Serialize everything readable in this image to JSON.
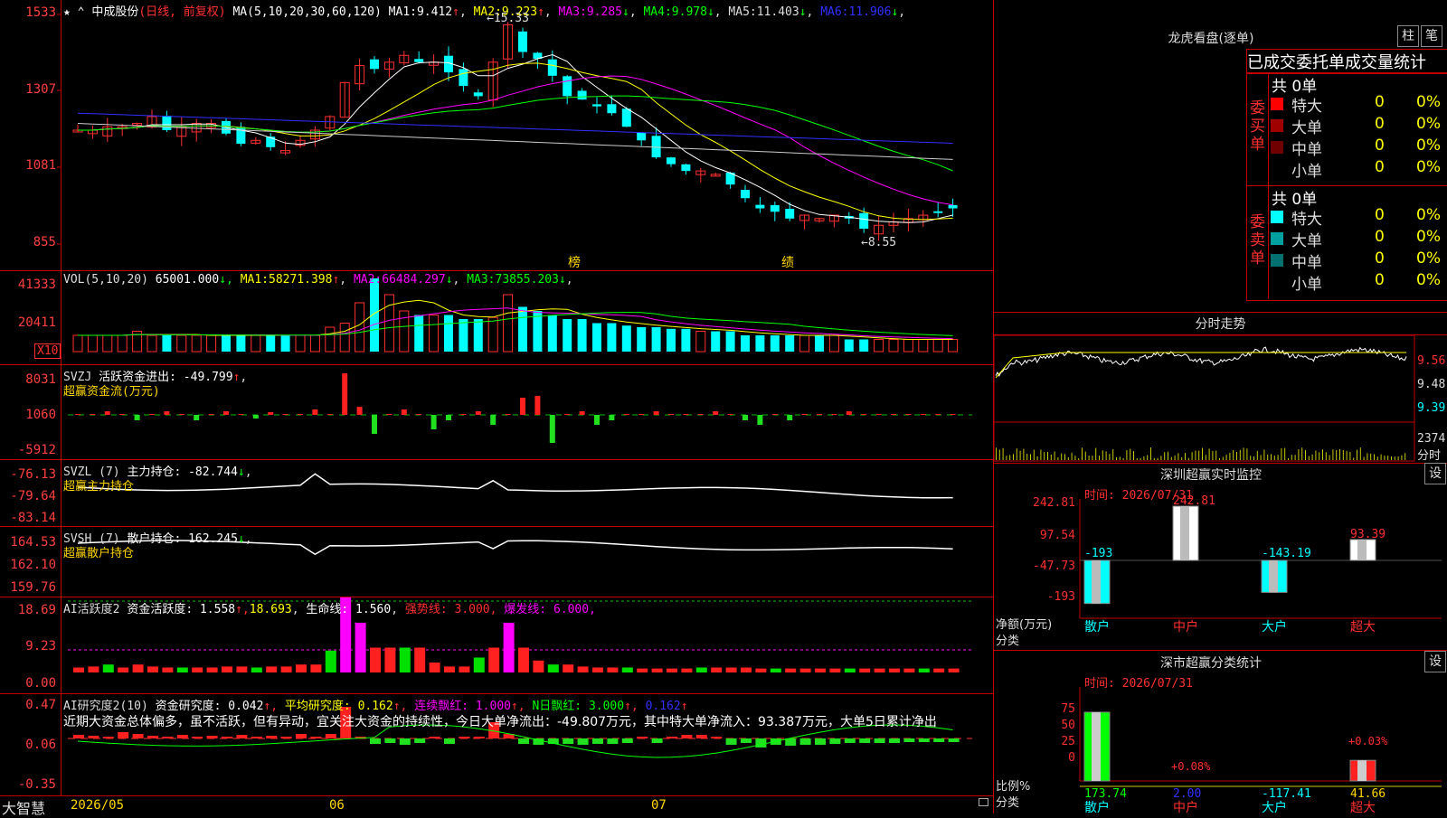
{
  "window": {
    "brand": "大智慧"
  },
  "kline": {
    "stock": "中成股份",
    "period": "(日线, 前复权)",
    "ma_params": "MA(5,10,20,30,60,120)",
    "ma": [
      {
        "label": "MA1:",
        "value": "9.412",
        "arrow": "↑",
        "color": "#ffffff"
      },
      {
        "label": "MA2:",
        "value": "9.223",
        "arrow": "↑",
        "color": "#ffff00"
      },
      {
        "label": "MA3:",
        "value": "9.285",
        "arrow": "↓",
        "color": "#ff00ff"
      },
      {
        "label": "MA4:",
        "value": "9.978",
        "arrow": "↓",
        "color": "#00ff00"
      },
      {
        "label": "MA5:",
        "value": "11.403",
        "arrow": "↓",
        "color": "#dddddd"
      },
      {
        "label": "MA6:",
        "value": "11.906",
        "arrow": "↓",
        "color": "#3030ff"
      }
    ],
    "y_labels": [
      "1533",
      "1307",
      "1081",
      "855"
    ],
    "high_mark": "15.33",
    "low_mark": "←8.55",
    "events": [
      "榜",
      "绩"
    ],
    "colors": {
      "up": "#ff3030",
      "down": "#00ffff"
    }
  },
  "vol": {
    "header": "VOL(5,10,20)",
    "value": "65001.000",
    "ma": [
      {
        "label": "MA1:",
        "value": "58271.398",
        "arrow": "↑",
        "color": "#ffff00"
      },
      {
        "label": "MA2:",
        "value": "66484.297",
        "arrow": "↓",
        "color": "#ff00ff"
      },
      {
        "label": "MA3:",
        "value": "73855.203",
        "arrow": "↓",
        "color": "#00ff00"
      }
    ],
    "y_labels": [
      "41333",
      "20411"
    ],
    "unit": "X10"
  },
  "svzj": {
    "name": "SVZJ",
    "label": "活跃资金进出:",
    "value": "-49.799",
    "arrow": "↑",
    "sub": "超赢资金流(万元)",
    "y_labels": [
      "8031",
      "1060",
      "-5912"
    ]
  },
  "svzl": {
    "name": "SVZL (7)",
    "label": "主力持仓:",
    "value": "-82.744",
    "arrow": "↓",
    "sub": "超赢主力持仓",
    "y_labels": [
      "-76.13",
      "-79.64",
      "-83.14"
    ]
  },
  "svsh": {
    "name": "SVSH (7)",
    "label": "散户持仓:",
    "value": "162.245",
    "arrow": "↓",
    "sub": "超赢散户持仓",
    "y_labels": [
      "164.53",
      "162.10",
      "159.76"
    ]
  },
  "ai_active": {
    "name": "AI活跃度2",
    "label": "资金活跃度:",
    "value": "1.558",
    "v2": "18.693",
    "life_label": "生命线:",
    "life": "1.560",
    "strong": "强势线: 3.000,",
    "burst": "爆发线: 6.000,",
    "y_labels": [
      "18.69",
      "9.23",
      "0.00"
    ]
  },
  "ai_research": {
    "name": "AI研究度2(10)",
    "label": "资金研究度:",
    "value": "0.042",
    "avg_label": "平均研究度:",
    "avg": "0.162",
    "streak_label": "连续飘红:",
    "streak": "1.000",
    "nday_label": "N日飘红:",
    "nday": "3.000",
    "last": "0.162",
    "comment": "近期大资金总体偏多，虽不活跃，但有异动，宜关注大资金的持续性，今日大单净流出：-49.807万元，其中特大单净流入：93.387万元，大单5日累计净出",
    "y_labels": [
      "0.47",
      "0.06",
      "-0.35"
    ]
  },
  "x_labels": [
    "2026/05",
    "06",
    "07"
  ],
  "dragon": {
    "title": "龙虎看盘(逐单)",
    "tabs": [
      "柱",
      "笔"
    ],
    "subtitle": "已成交委托单成交量统计",
    "buy_label": "委买单",
    "sell_label": "委卖单",
    "buy_total": "共 0单",
    "sell_total": "共 0单",
    "buy_rows": [
      {
        "name": "特大",
        "count": "0",
        "pct": "0%",
        "color": "#ff0000"
      },
      {
        "name": "大单",
        "count": "0",
        "pct": "0%",
        "color": "#a00000"
      },
      {
        "name": "中单",
        "count": "0",
        "pct": "0%",
        "color": "#700000"
      },
      {
        "name": "小单",
        "count": "0",
        "pct": "0%",
        "color": "#000000"
      }
    ],
    "sell_rows": [
      {
        "name": "特大",
        "count": "0",
        "pct": "0%",
        "color": "#00ffff"
      },
      {
        "name": "大单",
        "count": "0",
        "pct": "0%",
        "color": "#00a0a0"
      },
      {
        "name": "中单",
        "count": "0",
        "pct": "0%",
        "color": "#007070"
      },
      {
        "name": "小单",
        "count": "0",
        "pct": "0%",
        "color": "#000000"
      }
    ]
  },
  "intraday": {
    "title": "分时走势",
    "y_labels": [
      "9.56",
      "9.48",
      "9.39"
    ],
    "vol_label": "2374",
    "vol_unit": "分时"
  },
  "monitor": {
    "title": "深圳超赢实时监控",
    "button": "设",
    "time": "时间: 2026/07/31",
    "y_labels": [
      "242.81",
      "97.54",
      "-47.73",
      "-193"
    ],
    "values": [
      "-193",
      "242.81",
      "-143.19",
      "93.39"
    ],
    "ylabel": "净额(万元)",
    "xlabel": "分类",
    "cats": [
      "散户",
      "中户",
      "大户",
      "超大"
    ]
  },
  "classify": {
    "title": "深市超赢分类统计",
    "button": "设",
    "time": "时间: 2026/07/31",
    "y_labels": [
      "75",
      "50",
      "25",
      "0"
    ],
    "pct_labels": [
      "+0.08%",
      "+0.03%"
    ],
    "values": [
      "173.74",
      "2.00",
      "-117.41",
      "41.66"
    ],
    "ylabel": "比例%",
    "xlabel": "分类",
    "cats": [
      "散户",
      "中户",
      "大户",
      "超大"
    ]
  }
}
